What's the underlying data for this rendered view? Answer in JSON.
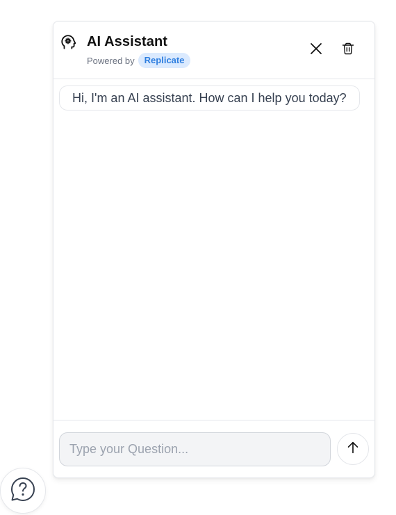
{
  "header": {
    "title": "AI Assistant",
    "powered_by_label": "Powered by",
    "provider_badge": "Replicate",
    "brand_icon": "head-gear-icon",
    "close_icon": "close-icon",
    "delete_icon": "trash-icon"
  },
  "messages": [
    {
      "role": "assistant",
      "text": "Hi, I'm an AI assistant. How can I help you today?"
    }
  ],
  "composer": {
    "placeholder": "Type your Question...",
    "value": "",
    "send_icon": "arrow-up-icon"
  },
  "help_button": {
    "icon": "question-bubble-icon"
  },
  "colors": {
    "badge_text": "#2f7fe0",
    "badge_bg": "#dbeafe",
    "border": "#e5e7eb",
    "input_bg": "#f3f4f6"
  }
}
